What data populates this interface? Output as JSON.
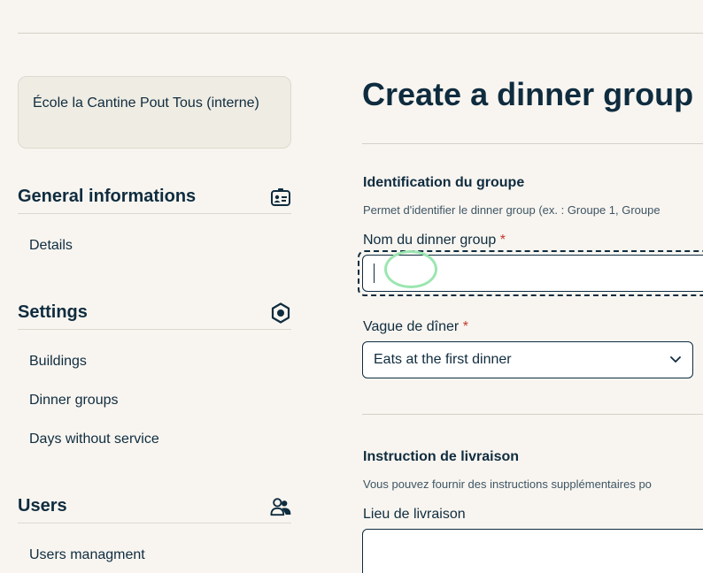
{
  "sidebar": {
    "org_name": "École la Cantine Pout Tous (interne)",
    "sections": [
      {
        "title": "General informations",
        "icon": "id-card-icon",
        "items": [
          "Details"
        ]
      },
      {
        "title": "Settings",
        "icon": "gear-icon",
        "items": [
          "Buildings",
          "Dinner groups",
          "Days without service"
        ]
      },
      {
        "title": "Users",
        "icon": "users-icon",
        "items": [
          "Users managment"
        ]
      }
    ]
  },
  "main": {
    "title": "Create a dinner group",
    "identification": {
      "title": "Identification du groupe",
      "description": "Permet d'identifier le dinner group (ex. : Groupe 1, Groupe",
      "name_label": "Nom du dinner group",
      "name_value": "",
      "wave_label": "Vague de dîner",
      "wave_selected": "Eats at the first dinner",
      "required_marker": "*"
    },
    "delivery": {
      "title": "Instruction de livraison",
      "description": "Vous pouvez fournir des instructions supplémentaires po",
      "location_label": "Lieu de livraison",
      "location_value": ""
    }
  },
  "colors": {
    "background": "#f8f5f0",
    "primary_text": "#0f2c3f",
    "required": "#c0392b",
    "card": "#efece3"
  }
}
